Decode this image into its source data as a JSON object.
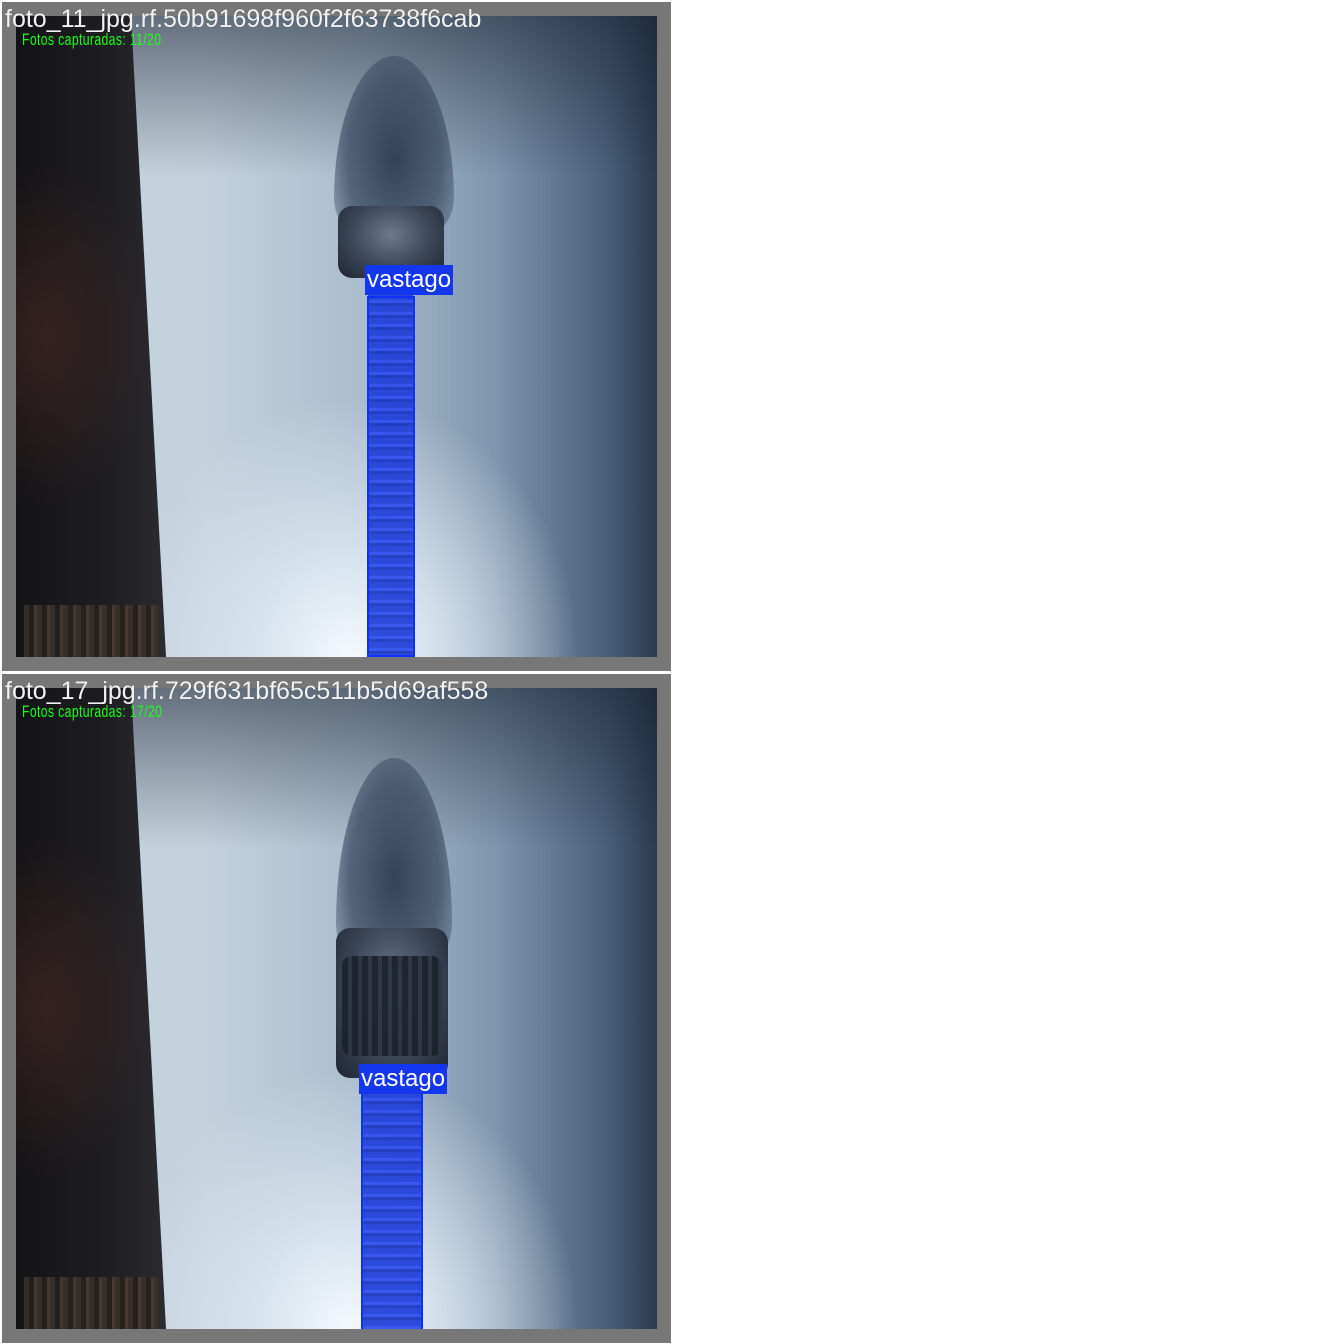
{
  "images": [
    {
      "filename": "foto_11_jpg.rf.50b91698f960f2f63738f6cab",
      "overlay": "Fotos capturadas: 11/20",
      "detection": {
        "label": "vastago",
        "color": "#1437ee"
      }
    },
    {
      "filename": "foto_17_jpg.rf.729f631bf65c511b5d69af558",
      "overlay": "Fotos capturadas: 17/20",
      "detection": {
        "label": "vastago",
        "color": "#1437ee"
      }
    }
  ]
}
